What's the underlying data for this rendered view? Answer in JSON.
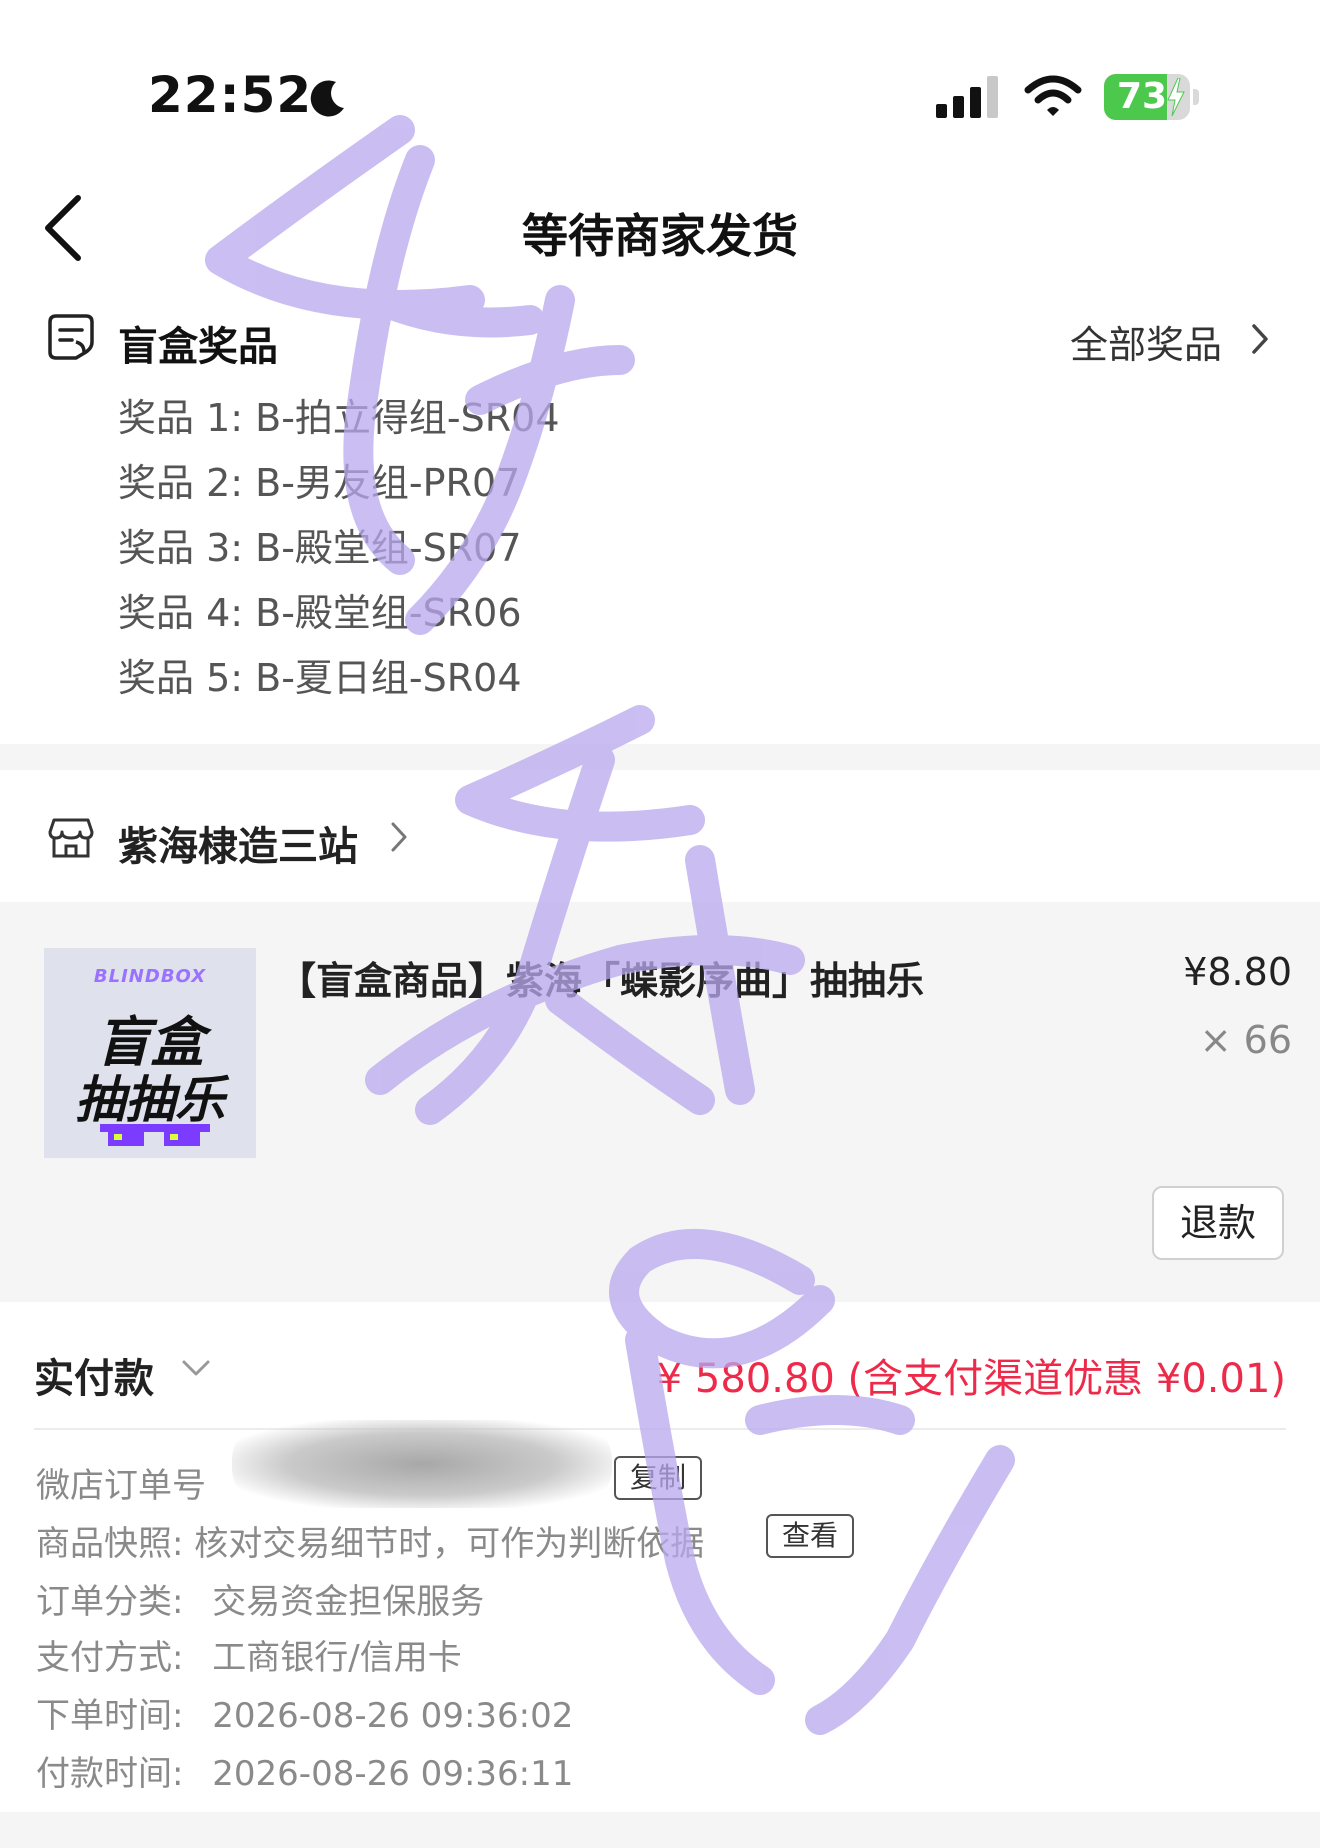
{
  "status_bar": {
    "time": "22:52",
    "battery_percent": "73",
    "battery_level": 0.73,
    "battery_color": "#4cc94c"
  },
  "nav": {
    "title": "等待商家发货"
  },
  "prizes": {
    "title": "盲盒奖品",
    "all_link": "全部奖品",
    "items": [
      "奖品 1: B-拍立得组-SR04",
      "奖品 2: B-男友组-PR07",
      "奖品 3: B-殿堂组-SR07",
      "奖品 4: B-殿堂组-SR06",
      "奖品 5: B-夏日组-SR04"
    ]
  },
  "store": {
    "name": "紫海棣造三站"
  },
  "product": {
    "thumb_brand": "BLINDBOX",
    "thumb_line1": "盲盒",
    "thumb_line2": "抽抽乐",
    "title": "【盲盒商品】紫海「蝶影序曲」抽抽乐",
    "price": "¥8.80",
    "quantity": "× 66",
    "refund_label": "退款"
  },
  "payment": {
    "label": "实付款",
    "amount": "¥ 580.80 (含支付渠道优惠 ¥0.01)",
    "accent_color": "#ee2a4a"
  },
  "order_info": {
    "order_no_key": "微店订单号",
    "copy_label": "复制",
    "snapshot_key": "商品快照:",
    "snapshot_val": "核对交易细节时，可作为判断依据",
    "view_label": "查看",
    "category_key": "订单分类:",
    "category_val": "交易资金担保服务",
    "paymethod_key": "支付方式:",
    "paymethod_val": "工商银行/信用卡",
    "order_time_key": "下单时间:",
    "order_time_val": "2026-08-26 09:36:02",
    "pay_time_key": "付款时间:",
    "pay_time_val": "2026-08-26 09:36:11"
  }
}
